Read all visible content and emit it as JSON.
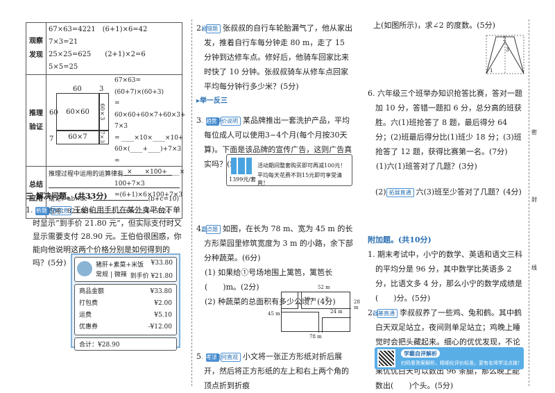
{
  "left": {
    "table": {
      "obs_label": "观察发现",
      "obs_lines": [
        "67×63=4221　(6+1)×6=42　7×3=21",
        "25×25=625　　(2+1)×2=6　 5×5=25"
      ],
      "reason_label": "推理验证",
      "diagram": {
        "top_60": "60",
        "top_3": "3",
        "left_60": "60",
        "left_7": "7",
        "cell_a": "60×60",
        "cell_b": "60×3",
        "cell_c": "60×7",
        "cell_d": "7×3"
      },
      "reason_lines": [
        "67×63=(60+7)×(60+3)",
        "= 60×60+60×7+60×3+",
        "7×3",
        "= ____×10×____×10+",
        "60×(____+____)+7×3",
        "= ____×____×100+____×",
        "100+7×3",
        "=(6+1)×6×100+7×3"
      ],
      "sum_label": "总结应用",
      "sum_lines": [
        "推理过程中运用的运算律有",
        "结论：ab×ac=",
        "(b+c=10)",
        "应用：82×88=",
        "6×",
        "4=5624"
      ]
    },
    "section_title": "三 解决问题。(共33分)",
    "q1": {
      "num": "1.",
      "tags": [
        "分析题",
        "图表信息"
      ],
      "text": "王伯伯用手机在某外卖平台下单时显示“到手价 21.80 元”，但实际支付时又显示需要支付 28.90 元。王伯伯很困惑，你能向他说明这两个价格分别是如何得到的吗？(5分)"
    },
    "receipt": {
      "item": "猪肝+素菜+米饭",
      "item_sub": "常规 | 微辣",
      "price": "¥33.80",
      "final_label": "到手价 ¥21.80",
      "rows": [
        [
          "商品金额",
          "¥33.80"
        ],
        [
          "打包费",
          "¥2.00"
        ],
        [
          "运费",
          "¥5.10"
        ],
        [
          "优惠券",
          "-¥12.00"
        ]
      ],
      "total": "合计：¥28.90"
    }
  },
  "middle": {
    "q2": {
      "num": "2.",
      "tag": "易错题",
      "text": "张叔叔的自行车轮胎漏气了，他从家出发，推着自行车每分钟走 80 m，走了 15 分钟到达修车点。修好后，他骑车回家比来时快了 10 分钟。张叔叔骑车从修车点回家平均每分钟行多少米？(5分)",
      "link": "▸举一反三"
    },
    "q3": {
      "num": "3.",
      "tags": [
        "新趋势",
        "评价说明"
      ],
      "text": "某品牌推出一套洗护产品，平均每位成人可以使用3~4个月(每个月按30天算)。下面是该品牌的宣传广告，这则广告真实吗？(5分)"
    },
    "ad": {
      "line1": "活动期间整套购买即可再减100元！",
      "line2": "平均每天花费不到15元即可享受清爽！",
      "price": "1399元/套"
    },
    "q4": {
      "num": "4.",
      "tag": "重点题",
      "text": "如图，在长为 78 m、宽为 45 m 的长方形菜园里修筑宽度为 3 m 的小路，余下部分种蔬菜。(6分)",
      "sub1": "(1) 如果给①号场地围上篱笆，篱笆长(　　)m。(2分)",
      "sub2": "(2) 种蔬菜的总面积有多少公顷？(4分)",
      "fig": {
        "w52": "52 m",
        "h19": "19 m",
        "c1": "①",
        "w24": "24 m",
        "h28": "28 m",
        "h45": "45 m",
        "w78": "78 m"
      }
    },
    "q5": {
      "num": "5.",
      "tags": [
        "新考法",
        "几何直观"
      ],
      "text": "小文将一张正方形纸对折后展开，然后将正方形纸的左上和右上两个角的顶点折到折痕"
    }
  },
  "right": {
    "q5_cont": "上(如图所示)，求∠2 的度数。(5分)",
    "fig_labels": [
      "2",
      "3",
      "1"
    ],
    "q6": {
      "num": "6.",
      "text": "六年级三个班举办知识抢答比赛，答对一题加 10 分，答错一题扣 6 分，总分高的班获胜。六(1)班抢答了 8 题，最后得分 64 分；(2)班最后得分比(1)班少 18 分；(3)班抢答了 12 题，获得比赛第一名。(7分)",
      "sub1": "(1)六(1)班答对了几题？(3分)",
      "sub2_pre": "(2)",
      "sub2_tag": "拓展直通",
      "sub2": "六(3)班至少答对了几题？(4分)"
    },
    "bonus_title": "附加题。(共10分)",
    "b1": {
      "num": "1.",
      "text": "期末考试中，小宁的数学、英语和语文三科的平均分是 96 分，其中数学比英语多 2 分，比语文多 4 分，那么小宁的数学成绩是(　　)分。(5分)"
    },
    "b2": {
      "num": "2.",
      "tag": "强基直通",
      "text": "李叔叔养了一些鸡、兔和鹤。其中鹤白天双足站立，夜间则单足站立；鸡晚上睡觉时会把头藏起来。细心的优优发现，不论白天还是夜晚，足数和头数的差都一样。如果优优白天可以数出 96 条腿，那么晚上能数出(　　)个头。(5分)"
    },
    "banner": {
      "title": "学霸自评解析",
      "text": "扫码看答案解析，精细化评价标准，更有名师学法点拨！"
    },
    "margin_marks": [
      "密",
      "封",
      "线"
    ]
  }
}
